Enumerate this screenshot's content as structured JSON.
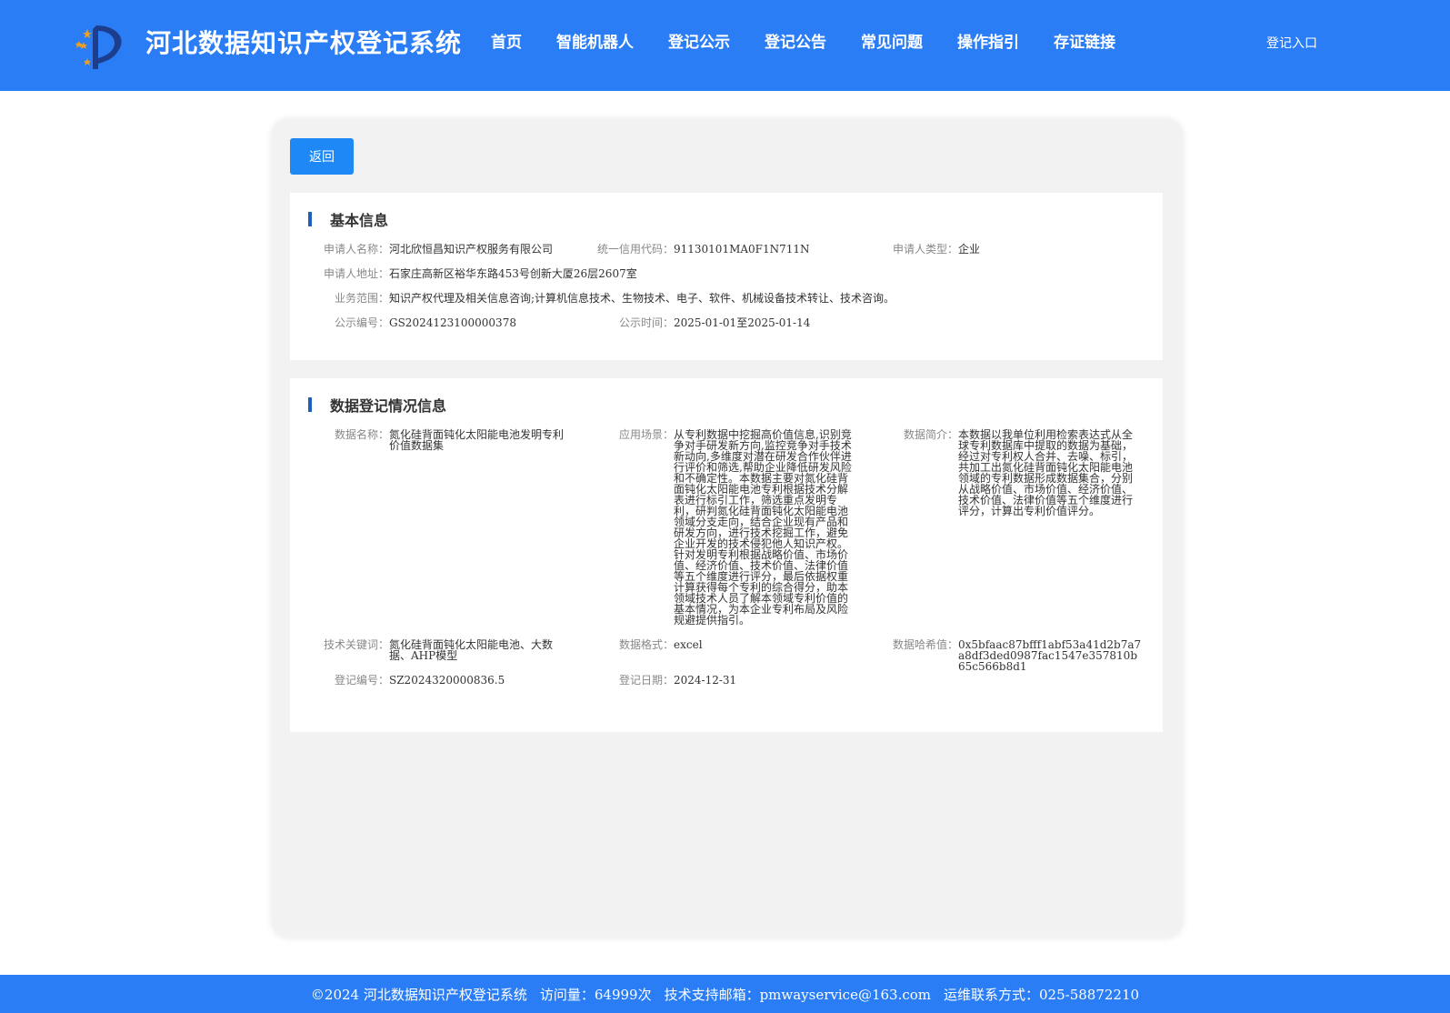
{
  "header": {
    "title": "河北数据知识产权登记系统",
    "nav": [
      "首页",
      "智能机器人",
      "登记公示",
      "登记公告",
      "常见问题",
      "操作指引",
      "存证链接"
    ],
    "login": "登记入口"
  },
  "back_label": "返回",
  "basic": {
    "title": "基本信息",
    "applicant_name_label": "申请人名称：",
    "applicant_name": "河北欣恒昌知识产权服务有限公司",
    "credit_code_label": "统一信用代码：",
    "credit_code": "91130101MA0F1N711N",
    "applicant_type_label": "申请人类型：",
    "applicant_type": "企业",
    "address_label": "申请人地址：",
    "address": "石家庄高新区裕华东路453号创新大厦26层2607室",
    "scope_label": "业务范围：",
    "scope": "知识产权代理及相关信息咨询;计算机信息技术、生物技术、电子、软件、机械设备技术转让、技术咨询。",
    "notice_no_label": "公示编号：",
    "notice_no": "GS2024123100000378",
    "notice_time_label": "公示时间：",
    "notice_time": "2025-01-01至2025-01-14"
  },
  "data": {
    "title": "数据登记情况信息",
    "name_label": "数据名称：",
    "name": "氮化硅背面钝化太阳能电池发明专利价值数据集",
    "scene_label": "应用场景：",
    "scene": "从专利数据中挖掘高价值信息,识别竞争对手研发新方向,监控竞争对手技术新动向,多维度对潜在研发合作伙伴进行评价和筛选,帮助企业降低研发风险和不确定性。本数据主要对氮化硅背面钝化太阳能电池专利根据技术分解表进行标引工作，筛选重点发明专利，研判氮化硅背面钝化太阳能电池领域分支走向，结合企业现有产品和研发方向，进行技术挖掘工作，避免企业开发的技术侵犯他人知识产权。针对发明专利根据战略价值、市场价值、经济价值、技术价值、法律价值等五个维度进行评分，最后依据权重计算获得每个专利的综合得分，助本领域技术人员了解本领域专利价值的基本情况，为本企业专利布局及风险规避提供指引。",
    "intro_label": "数据简介：",
    "intro": "本数据以我单位利用检索表达式从全球专利数据库中提取的数据为基础，经过对专利权人合并、去噪、标引，共加工出氮化硅背面钝化太阳能电池领域的专利数据形成数据集合，分别从战略价值、市场价值、经济价值、技术价值、法律价值等五个维度进行评分，计算出专利价值评分。",
    "keywords_label": "技术关键词：",
    "keywords": "氮化硅背面钝化太阳能电池、大数据、AHP模型",
    "format_label": "数据格式：",
    "format": "excel",
    "hash_label": "数据哈希值：",
    "hash": "0x5bfaac87bfff1abf53a41d2b7a7a8df3ded0987fac1547e357810b65c566b8d1",
    "reg_no_label": "登记编号：",
    "reg_no": "SZ2024320000836.5",
    "reg_date_label": "登记日期：",
    "reg_date": "2024-12-31"
  },
  "footer": {
    "copyright": "©2024 河北数据知识产权登记系统",
    "visits": "访问量：64999次",
    "email": "技术支持邮箱：pmwayservice@163.com",
    "phone": "运维联系方式：025-58872210"
  }
}
